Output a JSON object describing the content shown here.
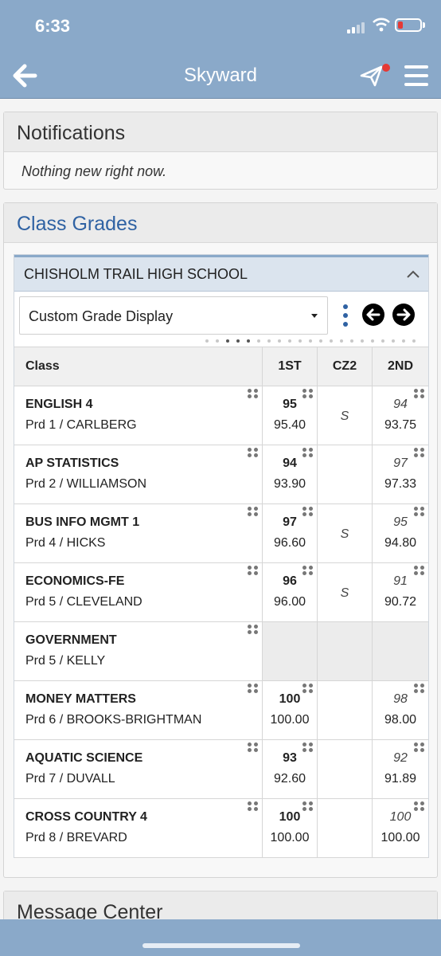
{
  "status": {
    "time": "6:33"
  },
  "nav": {
    "title": "Skyward"
  },
  "notifications": {
    "title": "Notifications",
    "message": "Nothing new right now."
  },
  "class_grades": {
    "title": "Class Grades",
    "school": "CHISHOLM TRAIL HIGH SCHOOL",
    "display_select": "Custom Grade Display",
    "columns": [
      "Class",
      "1ST",
      "CZ2",
      "2ND"
    ],
    "rows": [
      {
        "class": "ENGLISH 4",
        "period": "Prd 1 / CARLBERG",
        "first": "95",
        "first_pct": "95.40",
        "cz2": "S",
        "second": "94",
        "second_pct": "93.75"
      },
      {
        "class": "AP STATISTICS",
        "period": "Prd 2 / WILLIAMSON",
        "first": "94",
        "first_pct": "93.90",
        "cz2": "",
        "second": "97",
        "second_pct": "97.33"
      },
      {
        "class": "BUS INFO MGMT 1",
        "period": "Prd 4 / HICKS",
        "first": "97",
        "first_pct": "96.60",
        "cz2": "S",
        "second": "95",
        "second_pct": "94.80"
      },
      {
        "class": "ECONOMICS-FE",
        "period": "Prd 5 / CLEVELAND",
        "first": "96",
        "first_pct": "96.00",
        "cz2": "S",
        "second": "91",
        "second_pct": "90.72"
      },
      {
        "class": "GOVERNMENT",
        "period": "Prd 5 / KELLY",
        "first": "",
        "first_pct": "",
        "cz2": "",
        "second": "",
        "second_pct": ""
      },
      {
        "class": "MONEY MATTERS",
        "period": "Prd 6 / BROOKS-BRIGHTMAN",
        "first": "100",
        "first_pct": "100.00",
        "cz2": "",
        "second": "98",
        "second_pct": "98.00"
      },
      {
        "class": "AQUATIC SCIENCE",
        "period": "Prd 7 / DUVALL",
        "first": "93",
        "first_pct": "92.60",
        "cz2": "",
        "second": "92",
        "second_pct": "91.89"
      },
      {
        "class": "CROSS COUNTRY 4",
        "period": "Prd 8 / BREVARD",
        "first": "100",
        "first_pct": "100.00",
        "cz2": "",
        "second": "100",
        "second_pct": "100.00"
      }
    ]
  },
  "message_center": {
    "title": "Message Center"
  },
  "colors": {
    "nav_bar": "#8aa9c9",
    "accent": "#2f62a3",
    "notification_dot": "#e53935"
  }
}
